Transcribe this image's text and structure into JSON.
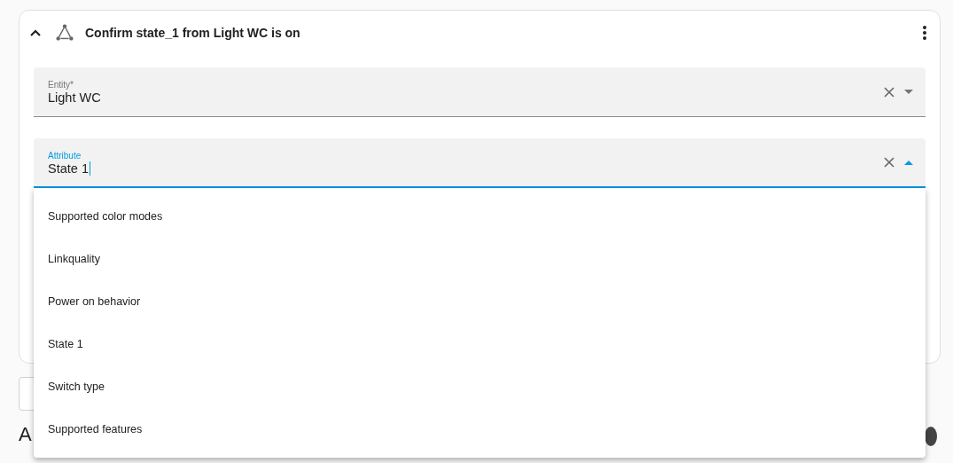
{
  "card": {
    "title": "Confirm state_1 from Light WC is on",
    "expanded": true
  },
  "fields": [
    {
      "label": "Entity*",
      "value": "Light WC",
      "focused": false
    },
    {
      "label": "Attribute",
      "value": "State 1",
      "focused": true
    }
  ],
  "menu": {
    "items": [
      {
        "label": "Supported color modes"
      },
      {
        "label": "Linkquality"
      },
      {
        "label": "Power on behavior"
      },
      {
        "label": "State 1"
      },
      {
        "label": "Switch type"
      },
      {
        "label": "Supported features"
      }
    ]
  },
  "heading": "A"
}
